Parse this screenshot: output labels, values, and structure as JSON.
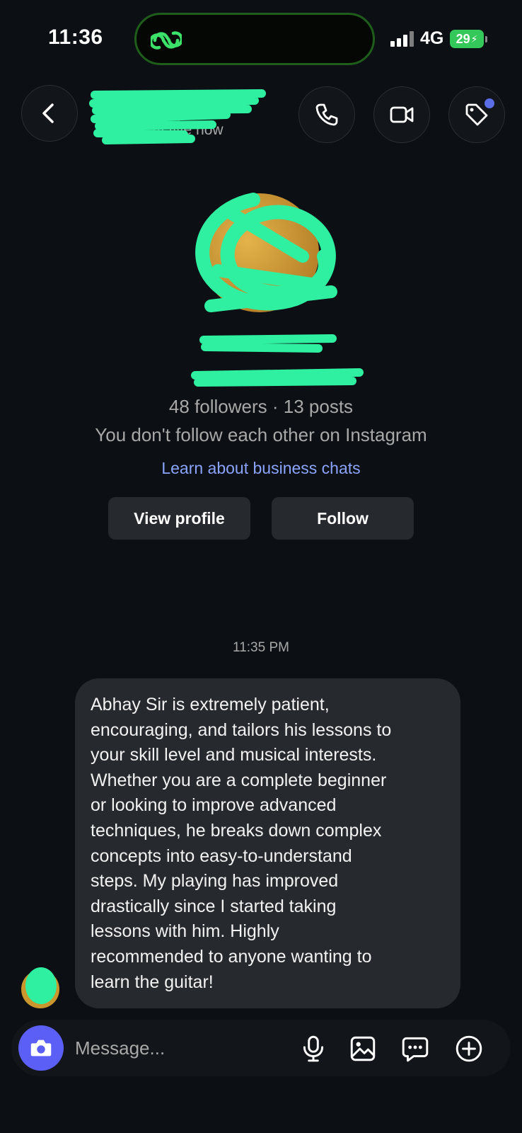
{
  "status_bar": {
    "time": "11:36",
    "network": "4G",
    "battery": "29"
  },
  "header": {
    "name": "",
    "status": "Active now",
    "icons": [
      "back-chevron-icon",
      "phone-icon",
      "video-camera-icon",
      "tag-icon"
    ]
  },
  "profile": {
    "name": "",
    "username": "",
    "stats": "48 followers · 13 posts",
    "mutual": "You don't follow each other on Instagram",
    "business_link": "Learn about business chats",
    "view_profile_label": "View profile",
    "follow_label": "Follow"
  },
  "chat": {
    "timestamp": "11:35 PM",
    "message_lines": [
      "Abhay Sir is extremely patient,",
      "encouraging, and tailors his lessons to",
      "your skill level and musical interests.",
      "Whether you are a complete beginner",
      "or looking to improve advanced",
      "techniques, he breaks down complex",
      "concepts into easy-to-understand",
      "steps. My playing has improved",
      "drastically since I started taking",
      "lessons with him. Highly",
      "recommended to anyone wanting to",
      "learn the guitar!"
    ]
  },
  "composer": {
    "placeholder": "Message...",
    "icons": [
      "camera-icon",
      "microphone-icon",
      "gallery-icon",
      "sticker-icon",
      "add-icon"
    ]
  },
  "colors": {
    "background": "#0c1014",
    "bubble": "#26292e",
    "accent": "#5b5ff6",
    "link": "#8aa4ff",
    "redaction": "#2ef0a0"
  }
}
